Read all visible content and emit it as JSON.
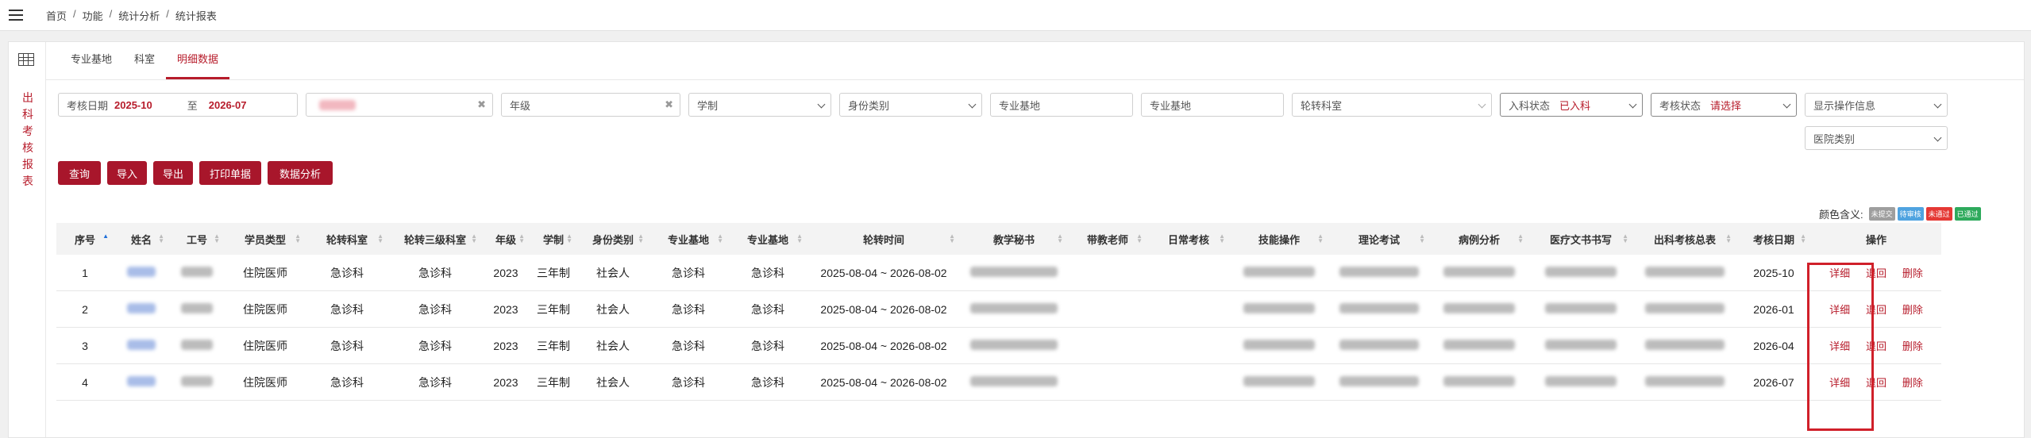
{
  "breadcrumb": [
    "首页",
    "功能",
    "统计分析",
    "统计报表"
  ],
  "breadcrumb_sep": "/",
  "side_title": [
    "出",
    "科",
    "考",
    "核",
    "报",
    "表"
  ],
  "tabs": [
    {
      "label": "专业基地",
      "active": false
    },
    {
      "label": "科室",
      "active": false
    },
    {
      "label": "明细数据",
      "active": true
    }
  ],
  "filters": {
    "exam_date_label": "考核日期",
    "exam_date_from": "2025-10",
    "exam_date_to_word": "至",
    "exam_date_to": "2026-07",
    "grade_placeholder": "年级",
    "program_placeholder": "学制",
    "identity_placeholder": "身份类别",
    "base1_placeholder": "专业基地",
    "base2_placeholder": "专业基地",
    "rotation_dept_placeholder": "轮转科室",
    "admission_status_label": "入科状态",
    "admission_status_value": "已入科",
    "exam_status_label": "考核状态",
    "exam_status_value": "请选择",
    "show_ops_select": "显示操作信息",
    "hospital_type_select": "医院类别"
  },
  "buttons": {
    "query": "查询",
    "import": "导入",
    "export": "导出",
    "print": "打印单据",
    "analysis": "数据分析"
  },
  "legend": {
    "label": "颜色含义:",
    "items": [
      {
        "text": "未提交",
        "color": "#9e9e9e"
      },
      {
        "text": "待审核",
        "color": "#4fa3e0"
      },
      {
        "text": "未通过",
        "color": "#e53935"
      },
      {
        "text": "已通过",
        "color": "#2eaa5c"
      }
    ]
  },
  "table": {
    "columns": [
      "序号",
      "姓名",
      "工号",
      "学员类型",
      "轮转科室",
      "轮转三级科室",
      "年级",
      "学制",
      "身份类别",
      "专业基地",
      "专业基地",
      "轮转时间",
      "教学秘书",
      "带教老师",
      "日常考核",
      "技能操作",
      "理论考试",
      "病例分析",
      "医疗文书书写",
      "出科考核总表",
      "考核日期",
      "操作"
    ],
    "rows": [
      {
        "no": "1",
        "type": "住院医师",
        "dept": "急诊科",
        "dept3": "急诊科",
        "grade": "2023",
        "program": "三年制",
        "identity": "社会人",
        "base1": "急诊科",
        "base2": "急诊科",
        "period": "2025-08-04 ~ 2026-08-02",
        "date": "2025-10"
      },
      {
        "no": "2",
        "type": "住院医师",
        "dept": "急诊科",
        "dept3": "急诊科",
        "grade": "2023",
        "program": "三年制",
        "identity": "社会人",
        "base1": "急诊科",
        "base2": "急诊科",
        "period": "2025-08-04 ~ 2026-08-02",
        "date": "2026-01"
      },
      {
        "no": "3",
        "type": "住院医师",
        "dept": "急诊科",
        "dept3": "急诊科",
        "grade": "2023",
        "program": "三年制",
        "identity": "社会人",
        "base1": "急诊科",
        "base2": "急诊科",
        "period": "2025-08-04 ~ 2026-08-02",
        "date": "2026-04"
      },
      {
        "no": "4",
        "type": "住院医师",
        "dept": "急诊科",
        "dept3": "急诊科",
        "grade": "2023",
        "program": "三年制",
        "identity": "社会人",
        "base1": "急诊科",
        "base2": "急诊科",
        "period": "2025-08-04 ~ 2026-08-02",
        "date": "2026-07"
      }
    ],
    "actions": [
      "详细",
      "退回",
      "删除"
    ]
  }
}
